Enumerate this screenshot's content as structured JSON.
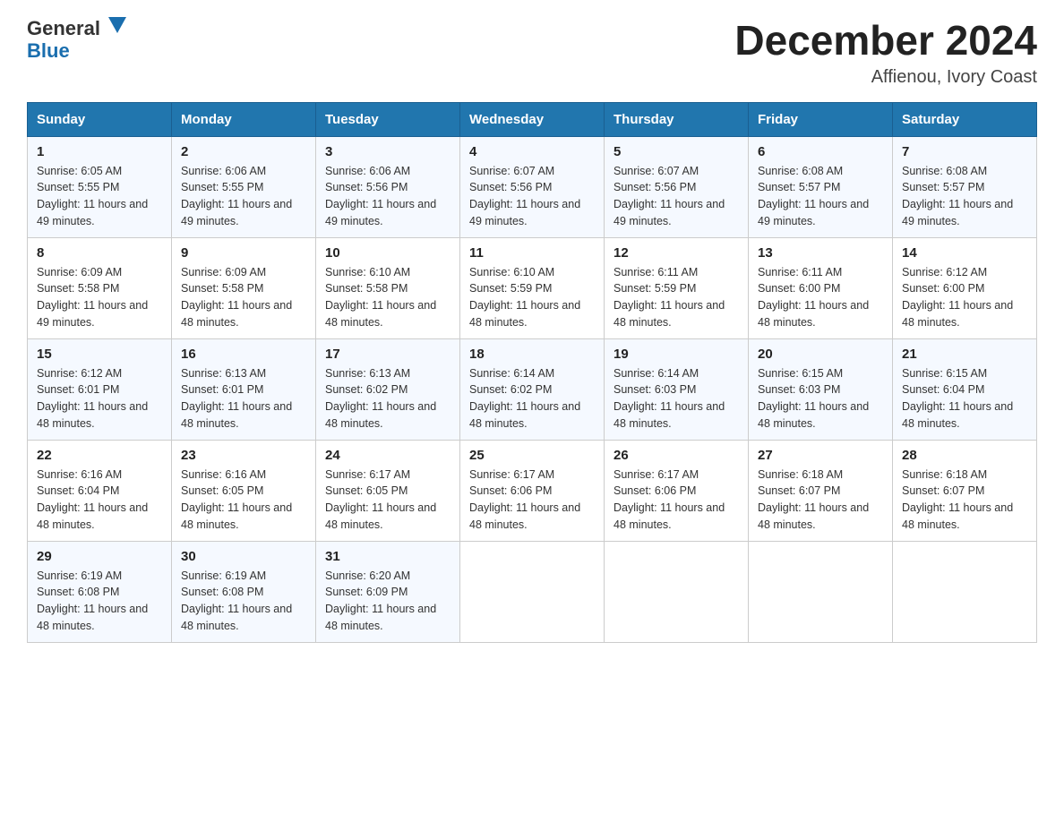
{
  "logo": {
    "text_general": "General",
    "text_blue": "Blue"
  },
  "title": "December 2024",
  "subtitle": "Affienou, Ivory Coast",
  "days_header": [
    "Sunday",
    "Monday",
    "Tuesday",
    "Wednesday",
    "Thursday",
    "Friday",
    "Saturday"
  ],
  "weeks": [
    [
      {
        "day": "1",
        "sunrise": "6:05 AM",
        "sunset": "5:55 PM",
        "daylight": "11 hours and 49 minutes."
      },
      {
        "day": "2",
        "sunrise": "6:06 AM",
        "sunset": "5:55 PM",
        "daylight": "11 hours and 49 minutes."
      },
      {
        "day": "3",
        "sunrise": "6:06 AM",
        "sunset": "5:56 PM",
        "daylight": "11 hours and 49 minutes."
      },
      {
        "day": "4",
        "sunrise": "6:07 AM",
        "sunset": "5:56 PM",
        "daylight": "11 hours and 49 minutes."
      },
      {
        "day": "5",
        "sunrise": "6:07 AM",
        "sunset": "5:56 PM",
        "daylight": "11 hours and 49 minutes."
      },
      {
        "day": "6",
        "sunrise": "6:08 AM",
        "sunset": "5:57 PM",
        "daylight": "11 hours and 49 minutes."
      },
      {
        "day": "7",
        "sunrise": "6:08 AM",
        "sunset": "5:57 PM",
        "daylight": "11 hours and 49 minutes."
      }
    ],
    [
      {
        "day": "8",
        "sunrise": "6:09 AM",
        "sunset": "5:58 PM",
        "daylight": "11 hours and 49 minutes."
      },
      {
        "day": "9",
        "sunrise": "6:09 AM",
        "sunset": "5:58 PM",
        "daylight": "11 hours and 48 minutes."
      },
      {
        "day": "10",
        "sunrise": "6:10 AM",
        "sunset": "5:58 PM",
        "daylight": "11 hours and 48 minutes."
      },
      {
        "day": "11",
        "sunrise": "6:10 AM",
        "sunset": "5:59 PM",
        "daylight": "11 hours and 48 minutes."
      },
      {
        "day": "12",
        "sunrise": "6:11 AM",
        "sunset": "5:59 PM",
        "daylight": "11 hours and 48 minutes."
      },
      {
        "day": "13",
        "sunrise": "6:11 AM",
        "sunset": "6:00 PM",
        "daylight": "11 hours and 48 minutes."
      },
      {
        "day": "14",
        "sunrise": "6:12 AM",
        "sunset": "6:00 PM",
        "daylight": "11 hours and 48 minutes."
      }
    ],
    [
      {
        "day": "15",
        "sunrise": "6:12 AM",
        "sunset": "6:01 PM",
        "daylight": "11 hours and 48 minutes."
      },
      {
        "day": "16",
        "sunrise": "6:13 AM",
        "sunset": "6:01 PM",
        "daylight": "11 hours and 48 minutes."
      },
      {
        "day": "17",
        "sunrise": "6:13 AM",
        "sunset": "6:02 PM",
        "daylight": "11 hours and 48 minutes."
      },
      {
        "day": "18",
        "sunrise": "6:14 AM",
        "sunset": "6:02 PM",
        "daylight": "11 hours and 48 minutes."
      },
      {
        "day": "19",
        "sunrise": "6:14 AM",
        "sunset": "6:03 PM",
        "daylight": "11 hours and 48 minutes."
      },
      {
        "day": "20",
        "sunrise": "6:15 AM",
        "sunset": "6:03 PM",
        "daylight": "11 hours and 48 minutes."
      },
      {
        "day": "21",
        "sunrise": "6:15 AM",
        "sunset": "6:04 PM",
        "daylight": "11 hours and 48 minutes."
      }
    ],
    [
      {
        "day": "22",
        "sunrise": "6:16 AM",
        "sunset": "6:04 PM",
        "daylight": "11 hours and 48 minutes."
      },
      {
        "day": "23",
        "sunrise": "6:16 AM",
        "sunset": "6:05 PM",
        "daylight": "11 hours and 48 minutes."
      },
      {
        "day": "24",
        "sunrise": "6:17 AM",
        "sunset": "6:05 PM",
        "daylight": "11 hours and 48 minutes."
      },
      {
        "day": "25",
        "sunrise": "6:17 AM",
        "sunset": "6:06 PM",
        "daylight": "11 hours and 48 minutes."
      },
      {
        "day": "26",
        "sunrise": "6:17 AM",
        "sunset": "6:06 PM",
        "daylight": "11 hours and 48 minutes."
      },
      {
        "day": "27",
        "sunrise": "6:18 AM",
        "sunset": "6:07 PM",
        "daylight": "11 hours and 48 minutes."
      },
      {
        "day": "28",
        "sunrise": "6:18 AM",
        "sunset": "6:07 PM",
        "daylight": "11 hours and 48 minutes."
      }
    ],
    [
      {
        "day": "29",
        "sunrise": "6:19 AM",
        "sunset": "6:08 PM",
        "daylight": "11 hours and 48 minutes."
      },
      {
        "day": "30",
        "sunrise": "6:19 AM",
        "sunset": "6:08 PM",
        "daylight": "11 hours and 48 minutes."
      },
      {
        "day": "31",
        "sunrise": "6:20 AM",
        "sunset": "6:09 PM",
        "daylight": "11 hours and 48 minutes."
      },
      null,
      null,
      null,
      null
    ]
  ],
  "labels": {
    "sunrise_prefix": "Sunrise: ",
    "sunset_prefix": "Sunset: ",
    "daylight_prefix": "Daylight: "
  }
}
